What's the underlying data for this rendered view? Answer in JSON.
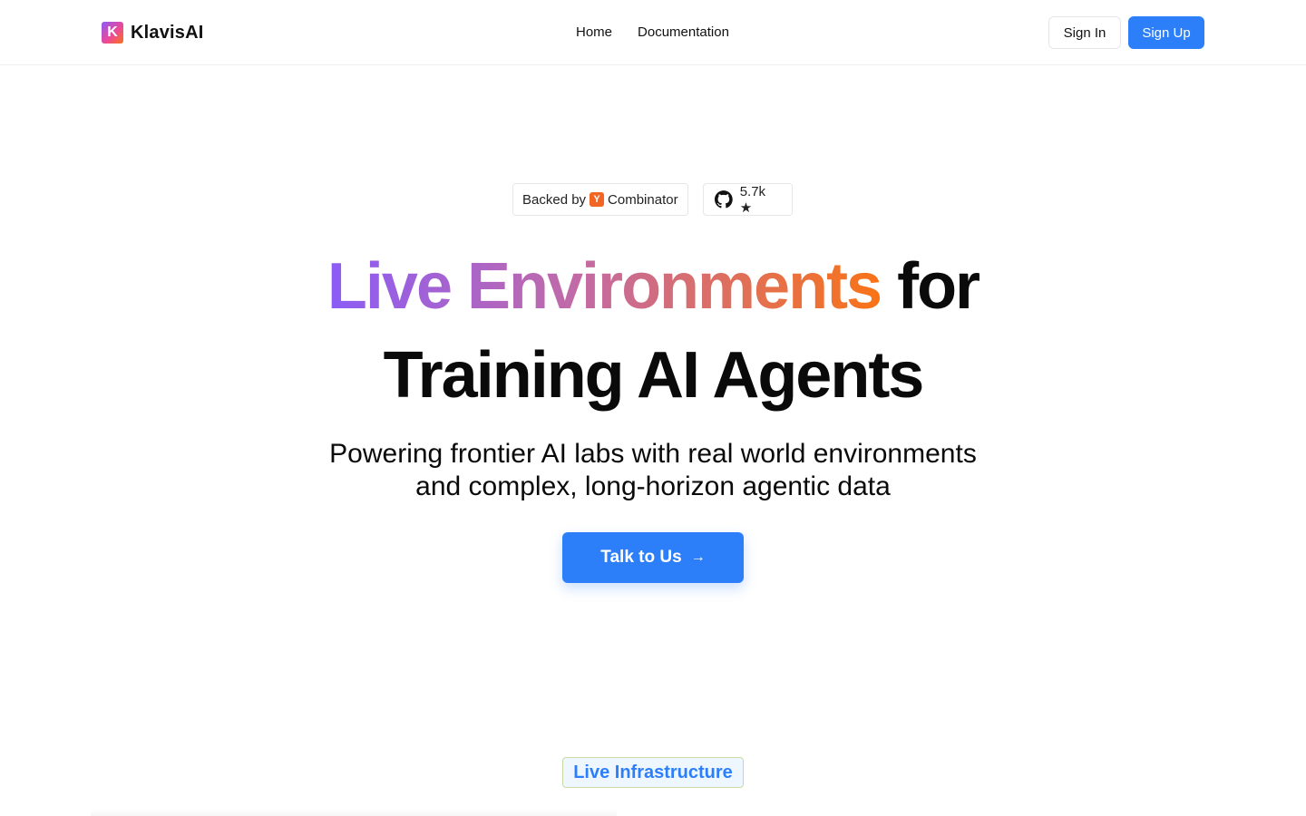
{
  "header": {
    "logo_letter": "K",
    "brand": "KlavisAI",
    "nav": [
      "Home",
      "Documentation"
    ],
    "signin_label": "Sign In",
    "signup_label": "Sign Up"
  },
  "badges": {
    "backed_by": "Backed by",
    "yc_letter": "Y",
    "combinator": "Combinator",
    "github_stars": "5.7k ★"
  },
  "hero": {
    "title_gradient": "Live Environments",
    "title_rest": " for",
    "title_line2": "Training AI Agents",
    "subtitle_line1": "Powering frontier AI labs with real world environments",
    "subtitle_line2": "and complex, long-horizon agentic data",
    "cta_label": "Talk to Us",
    "cta_arrow": "→"
  },
  "section": {
    "tag": "Live Infrastructure"
  },
  "colors": {
    "accent": "#2d7ff9",
    "gradient_start": "#8b5cf6",
    "gradient_end": "#f97316",
    "yc_orange": "#f26522"
  }
}
